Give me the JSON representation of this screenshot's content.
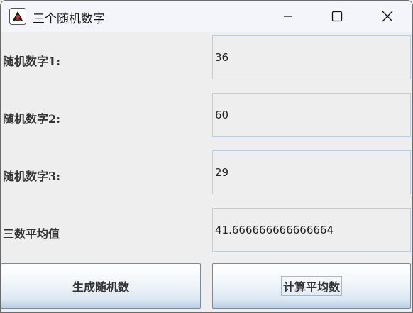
{
  "window": {
    "title": "三个随机数字"
  },
  "form": {
    "rows": [
      {
        "label": "随机数字1:",
        "value": "36"
      },
      {
        "label": "随机数字2:",
        "value": "60"
      },
      {
        "label": "随机数字3:",
        "value": "29"
      },
      {
        "label": "三数平均值",
        "value": "41.666666666666664"
      }
    ]
  },
  "buttons": {
    "generate_label": "生成随机数",
    "average_label": "计算平均数"
  },
  "icons": {
    "app": "java-duke-icon",
    "minimize": "minimize-icon",
    "maximize": "maximize-icon",
    "close": "close-icon"
  },
  "colors": {
    "field_border": "#b8cfe5",
    "button_gradient_bottom": "#b8cfe5",
    "titlebar": "#f3f5fb"
  }
}
